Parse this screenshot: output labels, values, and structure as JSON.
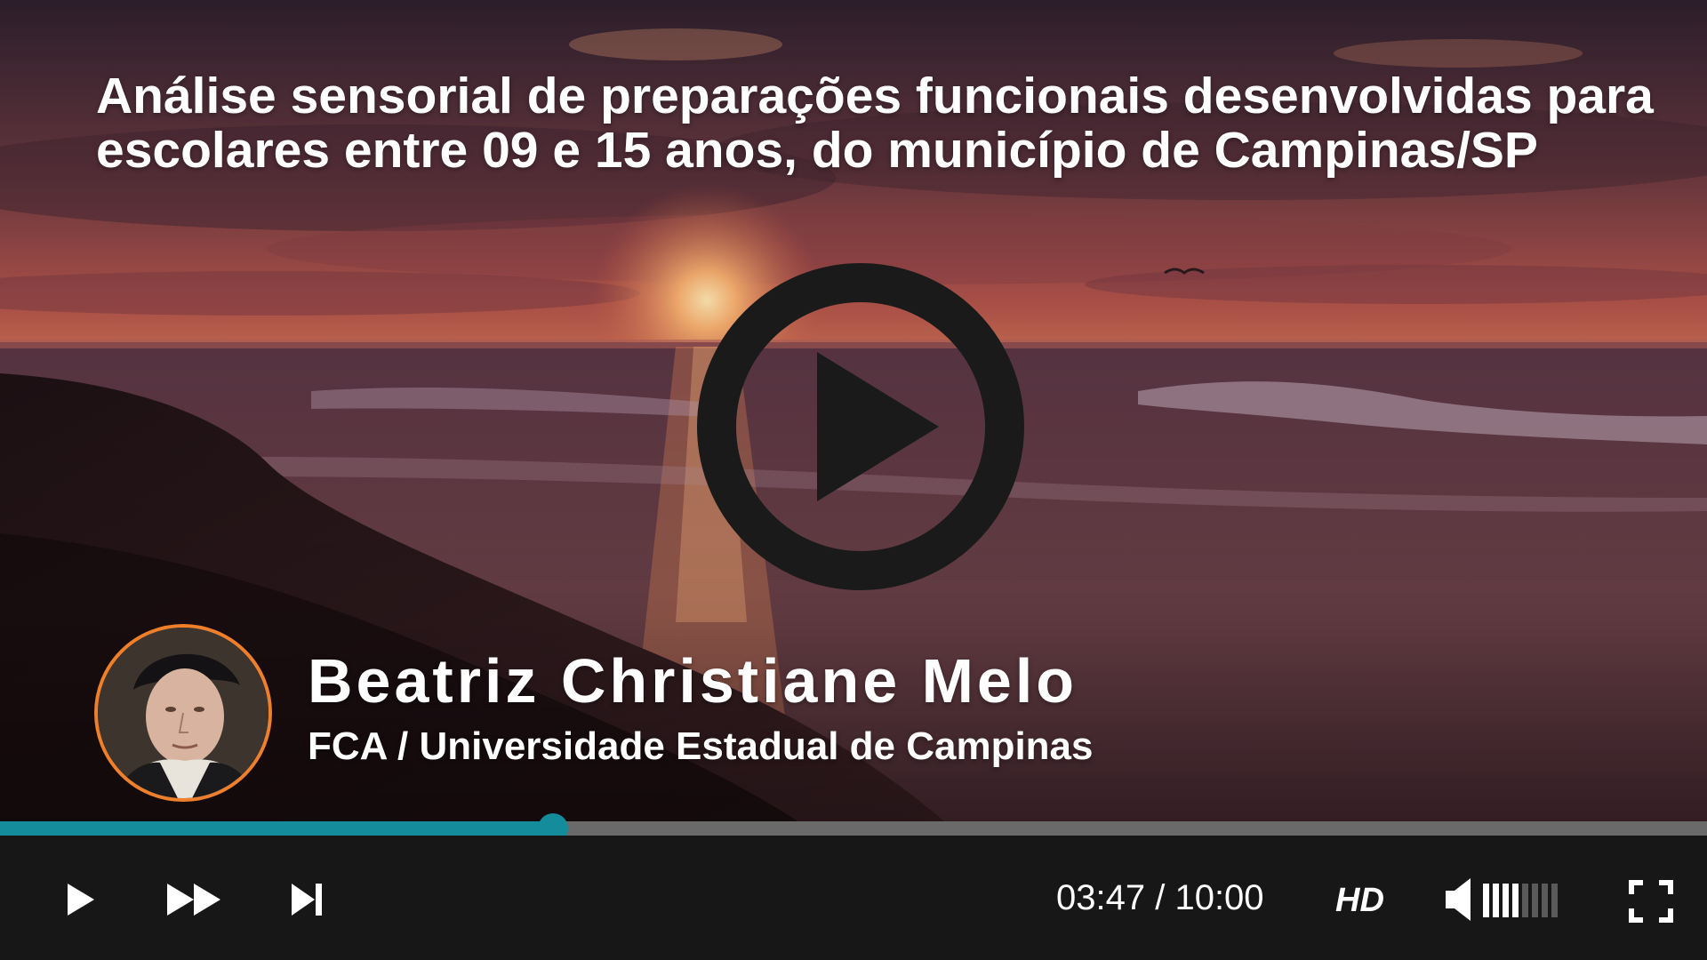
{
  "video": {
    "title": "Análise sensorial de preparações funcionais desenvolvidas para escolares entre 09 e 15 anos, do município de Campinas/SP",
    "presenter_name": "Beatriz Christiane Melo",
    "presenter_affiliation": "FCA / Universidade Estadual de Campinas",
    "big_play_icon": "play-circle-icon"
  },
  "playback": {
    "current_time": "03:47",
    "separator": " / ",
    "duration": "10:00",
    "progress_fraction": 0.324,
    "quality_label": "HD",
    "volume_level_fraction": 0.5
  },
  "controls": {
    "play_icon": "play-icon",
    "fast_forward_icon": "fast-forward-icon",
    "skip_next_icon": "skip-next-icon",
    "volume_icon": "volume-icon",
    "fullscreen_icon": "fullscreen-icon"
  },
  "colors": {
    "accent": "#148c9c",
    "avatar_ring": "#ef7f2a",
    "control_bar": "#171717",
    "progress_track": "#6a6a6a"
  }
}
